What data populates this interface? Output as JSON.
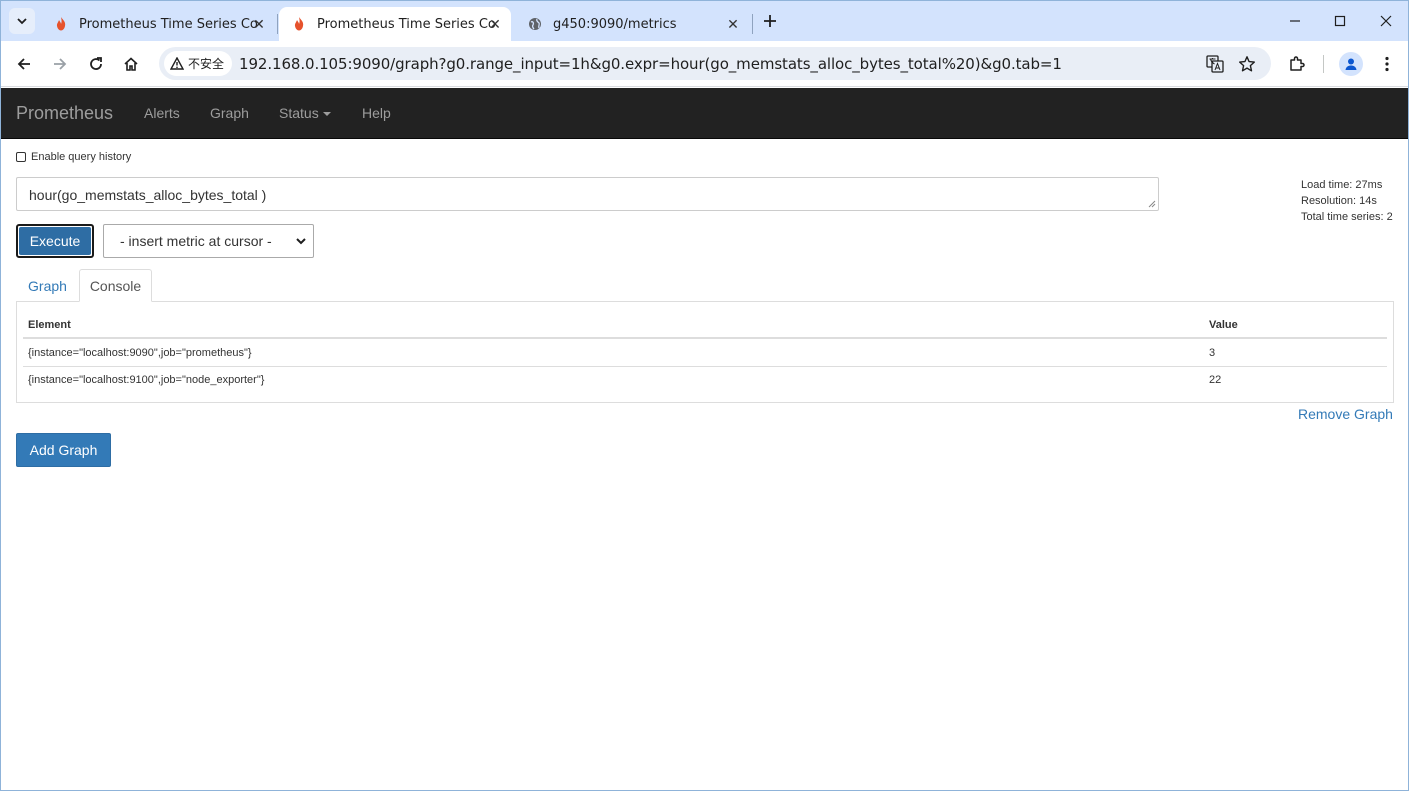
{
  "browser": {
    "tabs": [
      {
        "title": "Prometheus Time Series Colle",
        "favicon": "prometheus-flame-icon",
        "active": false
      },
      {
        "title": "Prometheus Time Series Colle",
        "favicon": "prometheus-flame-icon",
        "active": true
      },
      {
        "title": "g450:9090/metrics",
        "favicon": "globe-icon",
        "active": false
      }
    ],
    "security_label": "不安全",
    "url": "192.168.0.105:9090/graph?g0.range_input=1h&g0.expr=hour(go_memstats_alloc_bytes_total%20)&g0.tab=1"
  },
  "navbar": {
    "brand": "Prometheus",
    "links": [
      "Alerts",
      "Graph",
      "Status",
      "Help"
    ]
  },
  "page": {
    "history_label": "Enable query history",
    "expression": "hour(go_memstats_alloc_bytes_total )",
    "stats": {
      "load_time": "Load time: 27ms",
      "resolution": "Resolution: 14s",
      "total_series": "Total time series: 2"
    },
    "execute_label": "Execute",
    "metric_select": "- insert metric at cursor -",
    "tabs": {
      "graph": "Graph",
      "console": "Console"
    },
    "table": {
      "headers": [
        "Element",
        "Value"
      ],
      "rows": [
        [
          "{instance=\"localhost:9090\",job=\"prometheus\"}",
          "3"
        ],
        [
          "{instance=\"localhost:9100\",job=\"node_exporter\"}",
          "22"
        ]
      ]
    },
    "remove_graph": "Remove Graph",
    "add_graph": "Add Graph"
  },
  "colors": {
    "navbar_bg": "#222222",
    "link": "#337ab7",
    "button_primary": "#337ab7",
    "tabstrip_bg": "#d3e3fd"
  }
}
